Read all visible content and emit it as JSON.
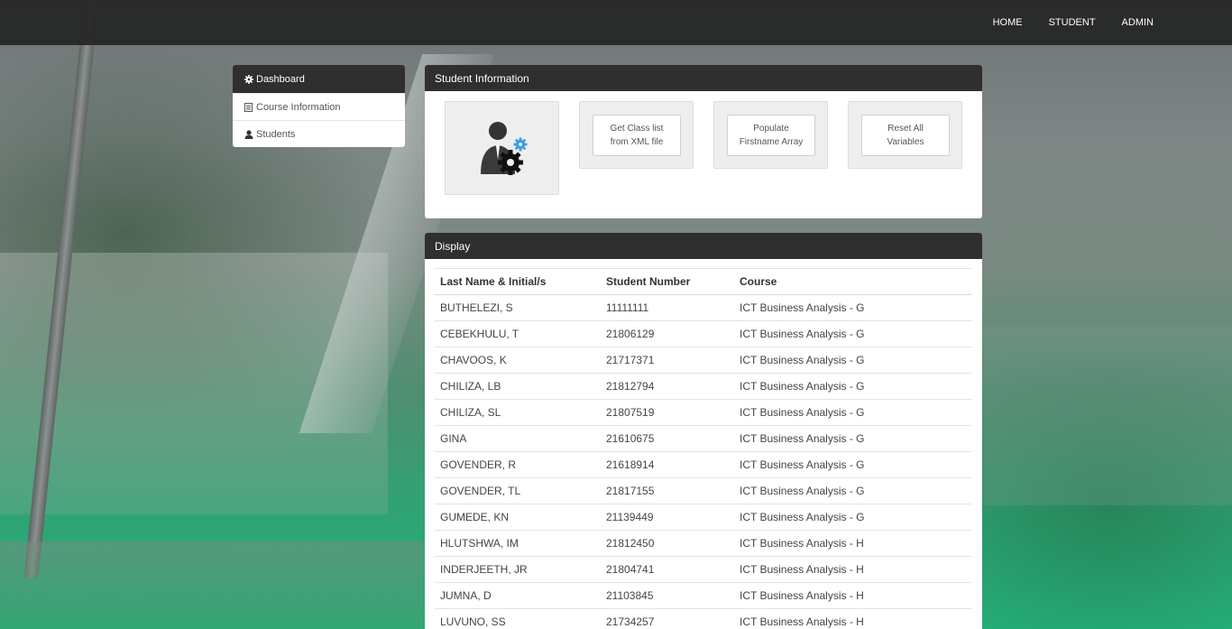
{
  "nav": {
    "home": "HOME",
    "student": "STUDENT",
    "admin": "ADMIN"
  },
  "sidebar": {
    "items": [
      {
        "label": "Dashboard",
        "icon": "gear-icon"
      },
      {
        "label": "Course Information",
        "icon": "book-icon"
      },
      {
        "label": "Students",
        "icon": "user-icon"
      }
    ]
  },
  "student_info": {
    "title": "Student Information",
    "icon": "user-gear-icon",
    "btn_get_class_line1": "Get Class list",
    "btn_get_class_line2": "from XML file",
    "btn_populate_line1": "Populate",
    "btn_populate_line2": "Firstname Array",
    "btn_reset_line1": "Reset All",
    "btn_reset_line2": "Variables"
  },
  "display": {
    "title": "Display",
    "headers": [
      "Last Name & Initial/s",
      "Student Number",
      "Course"
    ],
    "rows": [
      [
        "BUTHELEZI, S",
        "11111111",
        "ICT Business Analysis - G"
      ],
      [
        "CEBEKHULU, T",
        "21806129",
        "ICT Business Analysis - G"
      ],
      [
        "CHAVOOS, K",
        "21717371",
        "ICT Business Analysis - G"
      ],
      [
        "CHILIZA, LB",
        "21812794",
        "ICT Business Analysis - G"
      ],
      [
        "CHILIZA, SL",
        "21807519",
        "ICT Business Analysis - G"
      ],
      [
        "GINA",
        "21610675",
        "ICT Business Analysis - G"
      ],
      [
        "GOVENDER, R",
        "21618914",
        "ICT Business Analysis - G"
      ],
      [
        "GOVENDER, TL",
        "21817155",
        "ICT Business Analysis - G"
      ],
      [
        "GUMEDE, KN",
        "21139449",
        "ICT Business Analysis - G"
      ],
      [
        "HLUTSHWA, IM",
        "21812450",
        "ICT Business Analysis - H"
      ],
      [
        "INDERJEETH, JR",
        "21804741",
        "ICT Business Analysis - H"
      ],
      [
        "JUMNA, D",
        "21103845",
        "ICT Business Analysis - H"
      ],
      [
        "LUVUNO, SS",
        "21734257",
        "ICT Business Analysis - H"
      ]
    ]
  }
}
